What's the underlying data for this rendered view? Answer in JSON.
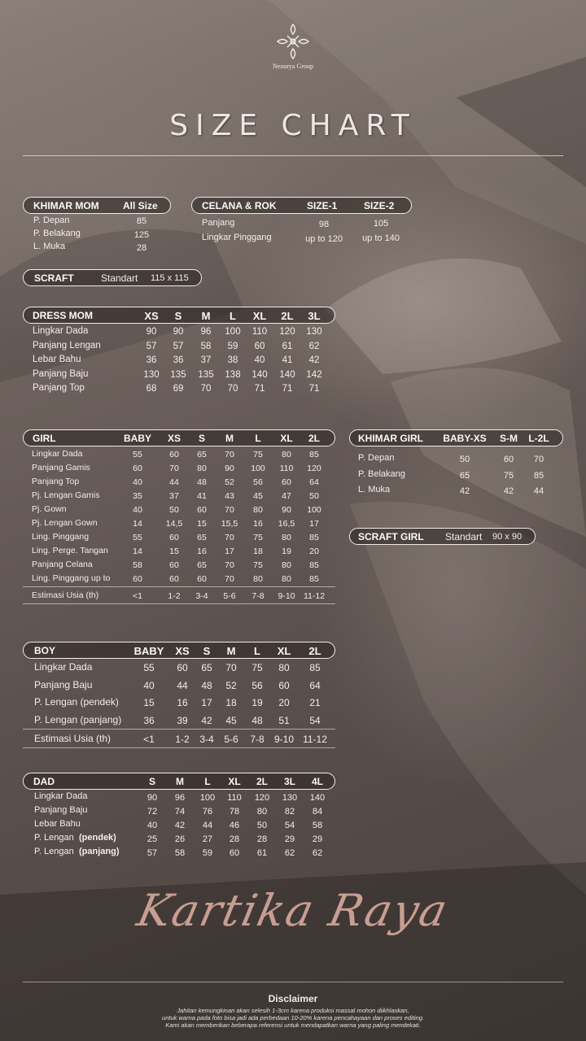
{
  "brand": {
    "name": "Nenurya Group",
    "logo_icon": "ornament-logo-icon"
  },
  "title": "SIZE CHART",
  "khimar_mom": {
    "header": "KHIMAR MOM",
    "col": "All Size",
    "rows": [
      {
        "label": "P. Depan",
        "value": "85"
      },
      {
        "label": "P. Belakang",
        "value": "125"
      },
      {
        "label": "L. Muka",
        "value": "28"
      }
    ]
  },
  "celana_rok": {
    "header": "CELANA & ROK",
    "cols": [
      "SIZE-1",
      "SIZE-2"
    ],
    "rows": [
      {
        "label": "Panjang",
        "values": [
          "98",
          "105"
        ]
      },
      {
        "label": "Lingkar Pinggang",
        "values": [
          "up to 120",
          "up to 140"
        ]
      }
    ]
  },
  "scraft": {
    "header": "SCRAFT",
    "label": "Standart",
    "value": "115 x 115"
  },
  "dress_mom": {
    "header": "DRESS MOM",
    "cols": [
      "XS",
      "S",
      "M",
      "L",
      "XL",
      "2L",
      "3L"
    ],
    "rows": [
      {
        "label": "Lingkar Dada",
        "values": [
          "90",
          "90",
          "96",
          "100",
          "110",
          "120",
          "130"
        ]
      },
      {
        "label": "Panjang Lengan",
        "values": [
          "57",
          "57",
          "58",
          "59",
          "60",
          "61",
          "62"
        ]
      },
      {
        "label": "Lebar Bahu",
        "values": [
          "36",
          "36",
          "37",
          "38",
          "40",
          "41",
          "42"
        ]
      },
      {
        "label": "Panjang Baju",
        "values": [
          "130",
          "135",
          "135",
          "138",
          "140",
          "140",
          "142"
        ]
      },
      {
        "label": "Panjang Top",
        "values": [
          "68",
          "69",
          "70",
          "70",
          "71",
          "71",
          "71"
        ]
      }
    ]
  },
  "girl": {
    "header": "GIRL",
    "cols": [
      "BABY",
      "XS",
      "S",
      "M",
      "L",
      "XL",
      "2L"
    ],
    "rows": [
      {
        "label": "Lingkar Dada",
        "values": [
          "55",
          "60",
          "65",
          "70",
          "75",
          "80",
          "85"
        ]
      },
      {
        "label": "Panjang Gamis",
        "values": [
          "60",
          "70",
          "80",
          "90",
          "100",
          "110",
          "120"
        ]
      },
      {
        "label": "Panjang Top",
        "values": [
          "40",
          "44",
          "48",
          "52",
          "56",
          "60",
          "64"
        ]
      },
      {
        "label": "Pj. Lengan Gamis",
        "values": [
          "35",
          "37",
          "41",
          "43",
          "45",
          "47",
          "50"
        ]
      },
      {
        "label": "Pj. Gown",
        "values": [
          "40",
          "50",
          "60",
          "70",
          "80",
          "90",
          "100"
        ]
      },
      {
        "label": "Pj. Lengan Gown",
        "values": [
          "14",
          "14,5",
          "15",
          "15,5",
          "16",
          "16,5",
          "17"
        ]
      },
      {
        "label": "Ling. Pinggang",
        "values": [
          "55",
          "60",
          "65",
          "70",
          "75",
          "80",
          "85"
        ]
      },
      {
        "label": "Ling. Perge. Tangan",
        "values": [
          "14",
          "15",
          "16",
          "17",
          "18",
          "19",
          "20"
        ]
      },
      {
        "label": "Panjang Celana",
        "values": [
          "58",
          "60",
          "65",
          "70",
          "75",
          "80",
          "85"
        ]
      },
      {
        "label": "Ling. Pinggang up to",
        "values": [
          "60",
          "60",
          "60",
          "70",
          "80",
          "80",
          "85"
        ]
      }
    ],
    "age": {
      "label": "Estimasi Usia (th)",
      "values": [
        "<1",
        "1-2",
        "3-4",
        "5-6",
        "7-8",
        "9-10",
        "11-12"
      ]
    }
  },
  "khimar_girl": {
    "header": "KHIMAR GIRL",
    "cols": [
      "BABY-XS",
      "S-M",
      "L-2L"
    ],
    "rows": [
      {
        "label": "P. Depan",
        "values": [
          "50",
          "60",
          "70"
        ]
      },
      {
        "label": "P. Belakang",
        "values": [
          "65",
          "75",
          "85"
        ]
      },
      {
        "label": "L. Muka",
        "values": [
          "42",
          "42",
          "44"
        ]
      }
    ]
  },
  "scraft_girl": {
    "header": "SCRAFT GIRL",
    "label": "Standart",
    "value": "90 x 90"
  },
  "boy": {
    "header": "BOY",
    "cols": [
      "BABY",
      "XS",
      "S",
      "M",
      "L",
      "XL",
      "2L"
    ],
    "rows": [
      {
        "label": "Lingkar Dada",
        "values": [
          "55",
          "60",
          "65",
          "70",
          "75",
          "80",
          "85"
        ]
      },
      {
        "label": "Panjang Baju",
        "values": [
          "40",
          "44",
          "48",
          "52",
          "56",
          "60",
          "64"
        ]
      },
      {
        "label": "P. Lengan (pendek)",
        "values": [
          "15",
          "16",
          "17",
          "18",
          "19",
          "20",
          "21"
        ]
      },
      {
        "label": "P. Lengan (panjang)",
        "values": [
          "36",
          "39",
          "42",
          "45",
          "48",
          "51",
          "54"
        ]
      }
    ],
    "age": {
      "label": "Estimasi Usia (th)",
      "values": [
        "<1",
        "1-2",
        "3-4",
        "5-6",
        "7-8",
        "9-10",
        "11-12"
      ]
    }
  },
  "dad": {
    "header": "DAD",
    "cols": [
      "S",
      "M",
      "L",
      "XL",
      "2L",
      "3L",
      "4L"
    ],
    "rows": [
      {
        "label": "Lingkar Dada",
        "values": [
          "90",
          "96",
          "100",
          "110",
          "120",
          "130",
          "140"
        ]
      },
      {
        "label": "Panjang Baju",
        "values": [
          "72",
          "74",
          "76",
          "78",
          "80",
          "82",
          "84"
        ]
      },
      {
        "label": "Lebar Bahu",
        "values": [
          "40",
          "42",
          "44",
          "46",
          "50",
          "54",
          "58"
        ]
      },
      {
        "label_main": "P. Lengan",
        "label_bold": "(pendek)",
        "values": [
          "25",
          "26",
          "27",
          "28",
          "28",
          "29",
          "29"
        ]
      },
      {
        "label_main": "P. Lengan",
        "label_bold": "(panjang)",
        "values": [
          "57",
          "58",
          "59",
          "60",
          "61",
          "62",
          "62"
        ]
      }
    ]
  },
  "signature": "Kartika Raya",
  "disclaimer": {
    "title": "Disclaimer",
    "lines": [
      "Jahitan kemungkinan akan selesih 1-3cm karena produksi massal mohon diikhlaskan,",
      "untuk warna pada foto bisa jadi ada perbedaan 10-20% karena pencahayaan dan proses editing.",
      "Kami akan memberikan beberapa referensi untuk mendapatkan warna yang paling mendekati."
    ]
  }
}
